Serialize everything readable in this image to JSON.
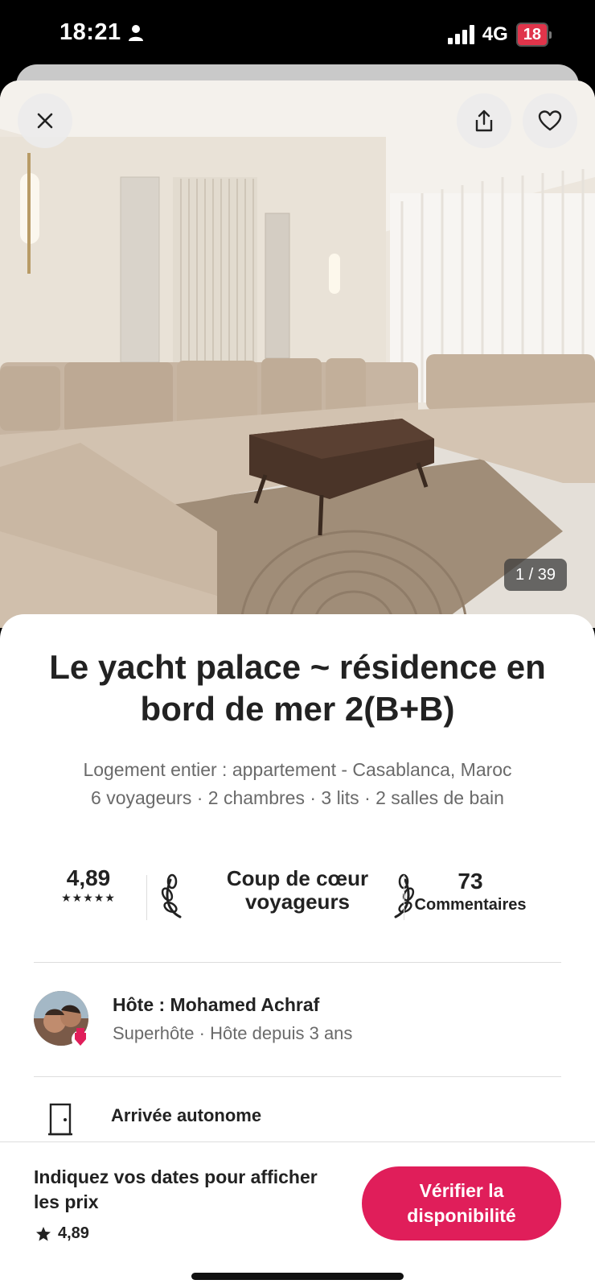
{
  "status_bar": {
    "time": "18:21",
    "network": "4G",
    "battery": "18"
  },
  "photo": {
    "counter": "1 / 39",
    "icons": [
      "close-icon",
      "share-icon",
      "heart-icon"
    ]
  },
  "listing": {
    "title": "Le yacht palace ~ résidence en bord de mer 2(B+B)",
    "subtitle_line1": "Logement entier : appartement - Casablanca, Maroc",
    "subtitle_line2": "6 voyageurs · 2 chambres · 3 lits · 2 salles de bain"
  },
  "stats": {
    "rating": "4,89",
    "stars": "★★★★★",
    "guest_favorite_line1": "Coup de cœur",
    "guest_favorite_line2": "voyageurs",
    "reviews_count": "73",
    "reviews_label": "Commentaires"
  },
  "host": {
    "name": "Hôte : Mohamed Achraf",
    "subtitle": "Superhôte · Hôte depuis 3 ans"
  },
  "features": [
    {
      "title": "Arrivée autonome",
      "icon": "door-icon"
    }
  ],
  "bottom_bar": {
    "price_prompt": "Indiquez vos dates pour afficher les prix",
    "rating": "4,89",
    "cta_label": "Vérifier la disponibilité"
  },
  "colors": {
    "accent": "#e01e5a",
    "text": "#222222",
    "muted": "#6a6a6a"
  }
}
